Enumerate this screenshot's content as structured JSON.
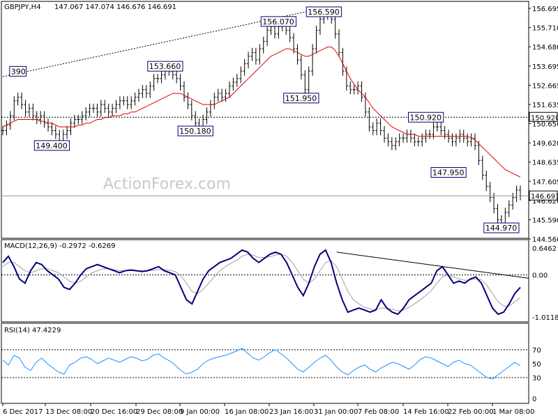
{
  "header": {
    "symbol": "GBPJPY,H4",
    "ohlc": "147.067 147.074 146.676 146.691",
    "macd_label": "MACD(12,26,9) -0.2972 -0.6269",
    "rsi_label": "RSI(14) 47.4229"
  },
  "watermark": "ActionForex.com",
  "colors": {
    "price": "#000000",
    "ma": "#e00000",
    "macd": "#00007a",
    "signal": "#a0a0a0",
    "rsi": "#1e90ff",
    "level_box": "#00007a",
    "grid": "#808080"
  },
  "chart_data": [
    {
      "type": "line",
      "panel": "price",
      "price_axis_ticks": [
        "156.695",
        "155.710",
        "154.680",
        "153.695",
        "152.665",
        "151.635",
        "150.650",
        "149.620",
        "148.635",
        "147.605",
        "146.620",
        "145.590",
        "144.560"
      ],
      "price_ylim": [
        144.56,
        157.0
      ],
      "x_tick_labels": [
        "6 Dec 2017",
        "13 Dec 08:00",
        "20 Dec 16:00",
        "29 Dec 08:00",
        "9 Jan 00:00",
        "16 Jan 08:00",
        "23 Jan 16:00",
        "31 Jan 00:00",
        "7 Feb 08:00",
        "14 Feb 16:00",
        "22 Feb 00:00",
        "1 Mar 08:00"
      ],
      "series": [
        {
          "values": [
            150.2,
            150.5,
            151.0,
            151.8,
            152.0,
            151.6,
            151.2,
            151.4,
            151.0,
            150.8,
            151.0,
            150.6,
            150.4,
            150.2,
            150.0,
            149.6,
            150.0,
            150.2,
            150.6,
            150.8,
            150.8,
            151.0,
            151.2,
            151.4,
            151.4,
            151.2,
            151.6,
            151.4,
            151.2,
            151.4,
            151.6,
            151.8,
            151.8,
            151.6,
            151.8,
            152.0,
            152.2,
            152.4,
            152.2,
            152.6,
            153.0,
            153.0,
            153.2,
            153.6,
            153.4,
            153.2,
            153.0,
            152.6,
            152.0,
            151.6,
            151.0,
            150.6,
            150.4,
            150.8,
            151.2,
            151.6,
            152.0,
            152.2,
            152.0,
            152.2,
            152.6,
            152.8,
            153.0,
            153.4,
            153.8,
            154.2,
            154.4,
            154.0,
            154.6,
            155.0,
            155.6,
            155.8,
            155.4,
            155.8,
            156.0,
            155.6,
            155.2,
            154.6,
            154.0,
            153.2,
            152.4,
            153.4,
            154.6,
            155.6,
            156.2,
            156.4,
            156.6,
            156.2,
            155.4,
            154.4,
            153.4,
            152.6,
            152.4,
            152.4,
            152.6,
            152.0,
            151.2,
            150.4,
            150.2,
            150.6,
            150.2,
            149.8,
            149.6,
            149.4,
            149.6,
            149.8,
            149.8,
            150.0,
            149.8,
            149.6,
            149.6,
            149.8,
            150.0,
            150.0,
            150.4,
            150.4,
            150.2,
            150.0,
            149.8,
            149.6,
            149.8,
            150.0,
            149.8,
            149.6,
            149.8,
            149.4,
            148.6,
            147.8,
            147.2,
            146.6,
            146.0,
            145.4,
            145.2,
            145.8,
            146.2,
            146.6,
            147.0,
            146.7
          ],
          "ma_values": [
            150.4,
            150.5,
            150.6,
            150.7,
            150.8,
            150.8,
            150.8,
            150.8,
            150.8,
            150.8,
            150.7,
            150.7,
            150.6,
            150.6,
            150.5,
            150.4,
            150.4,
            150.4,
            150.4,
            150.4,
            150.5,
            150.5,
            150.6,
            150.6,
            150.7,
            150.8,
            150.8,
            150.9,
            150.9,
            151.0,
            151.0,
            151.0,
            151.1,
            151.1,
            151.2,
            151.2,
            151.3,
            151.4,
            151.5,
            151.6,
            151.7,
            151.8,
            151.9,
            152.0,
            152.1,
            152.2,
            152.2,
            152.2,
            152.1,
            152.0,
            151.9,
            151.8,
            151.7,
            151.6,
            151.6,
            151.6,
            151.6,
            151.7,
            151.8,
            151.9,
            152.0,
            152.2,
            152.4,
            152.6,
            152.8,
            153.0,
            153.2,
            153.4,
            153.6,
            153.8,
            154.0,
            154.2,
            154.3,
            154.4,
            154.5,
            154.6,
            154.6,
            154.5,
            154.4,
            154.3,
            154.2,
            154.2,
            154.3,
            154.4,
            154.5,
            154.6,
            154.7,
            154.7,
            154.5,
            154.2,
            153.8,
            153.4,
            153.0,
            152.7,
            152.4,
            152.2,
            152.0,
            151.7,
            151.4,
            151.2,
            151.0,
            150.8,
            150.6,
            150.4,
            150.3,
            150.2,
            150.1,
            150.0,
            150.0,
            150.0,
            149.9,
            149.9,
            149.9,
            149.9,
            149.9,
            149.9,
            149.9,
            149.9,
            149.9,
            149.9,
            149.9,
            149.9,
            149.9,
            149.9,
            149.8,
            149.7,
            149.5,
            149.3,
            149.1,
            148.9,
            148.7,
            148.5,
            148.3,
            148.1,
            148.0,
            147.9,
            147.8,
            147.7
          ]
        }
      ],
      "levels": [
        {
          "label": "390",
          "value": 153.39
        },
        {
          "label": "149.400",
          "value": 149.4
        },
        {
          "label": "153.660",
          "value": 153.66
        },
        {
          "label": "150.180",
          "value": 150.18
        },
        {
          "label": "156.070",
          "value": 156.07
        },
        {
          "label": "156.590",
          "value": 156.59
        },
        {
          "label": "151.950",
          "value": 151.95
        },
        {
          "label": "147.950",
          "value": 147.95
        },
        {
          "label": "150.920",
          "value": 150.92
        },
        {
          "label": "144.970",
          "value": 144.97
        }
      ],
      "horizontal_lines": [
        {
          "label": "150.920",
          "value": 150.92,
          "style": "dotted"
        },
        {
          "label": "146.691",
          "value": 146.691,
          "style": "solid"
        }
      ],
      "trendline": {
        "style": "dotted"
      }
    },
    {
      "type": "line",
      "panel": "macd",
      "ticks": [
        "0.6462",
        "0.00",
        "-1.0118"
      ],
      "ylim": [
        -1.1,
        0.75
      ],
      "series": [
        {
          "name": "MACD",
          "values": [
            0.3,
            0.45,
            0.2,
            -0.1,
            -0.2,
            0.1,
            0.3,
            0.25,
            0.1,
            0.0,
            -0.1,
            -0.3,
            -0.35,
            -0.2,
            0.0,
            0.15,
            0.2,
            0.25,
            0.2,
            0.15,
            0.1,
            0.05,
            0.1,
            0.12,
            0.1,
            0.08,
            0.1,
            0.15,
            0.2,
            0.1,
            0.05,
            0.0,
            -0.3,
            -0.6,
            -0.7,
            -0.4,
            -0.1,
            0.1,
            0.2,
            0.3,
            0.35,
            0.4,
            0.5,
            0.6,
            0.55,
            0.4,
            0.3,
            0.4,
            0.5,
            0.55,
            0.5,
            0.3,
            0.0,
            -0.3,
            -0.5,
            -0.2,
            0.2,
            0.5,
            0.6,
            0.3,
            -0.2,
            -0.6,
            -0.9,
            -0.85,
            -0.8,
            -0.85,
            -0.9,
            -0.85,
            -0.6,
            -0.8,
            -0.9,
            -0.95,
            -0.8,
            -0.6,
            -0.5,
            -0.4,
            -0.3,
            -0.2,
            0.1,
            0.2,
            0.0,
            -0.2,
            -0.15,
            -0.2,
            -0.1,
            -0.05,
            -0.2,
            -0.5,
            -0.8,
            -0.95,
            -0.9,
            -0.7,
            -0.45,
            -0.3
          ]
        },
        {
          "name": "Signal",
          "values": [
            0.2,
            0.3,
            0.3,
            0.2,
            0.1,
            0.05,
            0.1,
            0.15,
            0.15,
            0.1,
            0.05,
            -0.05,
            -0.15,
            -0.2,
            -0.15,
            -0.05,
            0.05,
            0.1,
            0.15,
            0.15,
            0.13,
            0.1,
            0.1,
            0.1,
            0.1,
            0.1,
            0.1,
            0.11,
            0.13,
            0.13,
            0.11,
            0.08,
            -0.02,
            -0.2,
            -0.4,
            -0.45,
            -0.35,
            -0.2,
            -0.05,
            0.1,
            0.2,
            0.28,
            0.35,
            0.45,
            0.5,
            0.48,
            0.42,
            0.42,
            0.44,
            0.48,
            0.5,
            0.45,
            0.3,
            0.1,
            -0.1,
            -0.2,
            -0.1,
            0.1,
            0.3,
            0.35,
            0.2,
            -0.1,
            -0.4,
            -0.6,
            -0.7,
            -0.78,
            -0.82,
            -0.85,
            -0.8,
            -0.8,
            -0.83,
            -0.87,
            -0.85,
            -0.78,
            -0.7,
            -0.6,
            -0.5,
            -0.38,
            -0.2,
            -0.05,
            0.0,
            -0.05,
            -0.1,
            -0.13,
            -0.12,
            -0.1,
            -0.12,
            -0.25,
            -0.45,
            -0.65,
            -0.75,
            -0.75,
            -0.65,
            -0.55
          ]
        }
      ]
    },
    {
      "type": "line",
      "panel": "rsi",
      "ticks": [
        "70",
        "50",
        "30",
        "0"
      ],
      "ylim": [
        0,
        100
      ],
      "series": [
        {
          "name": "RSI",
          "values": [
            55,
            48,
            62,
            58,
            45,
            40,
            52,
            58,
            50,
            44,
            38,
            35,
            48,
            52,
            58,
            60,
            56,
            50,
            54,
            58,
            55,
            52,
            56,
            60,
            58,
            54,
            56,
            62,
            64,
            58,
            54,
            48,
            40,
            35,
            38,
            42,
            50,
            55,
            58,
            60,
            62,
            65,
            68,
            72,
            65,
            58,
            55,
            60,
            66,
            70,
            64,
            58,
            50,
            42,
            38,
            45,
            52,
            58,
            62,
            55,
            45,
            38,
            34,
            40,
            45,
            48,
            42,
            38,
            44,
            48,
            52,
            50,
            46,
            42,
            48,
            56,
            60,
            58,
            54,
            50,
            46,
            52,
            55,
            50,
            48,
            42,
            36,
            30,
            28,
            34,
            40,
            46,
            52,
            47
          ]
        }
      ]
    }
  ]
}
